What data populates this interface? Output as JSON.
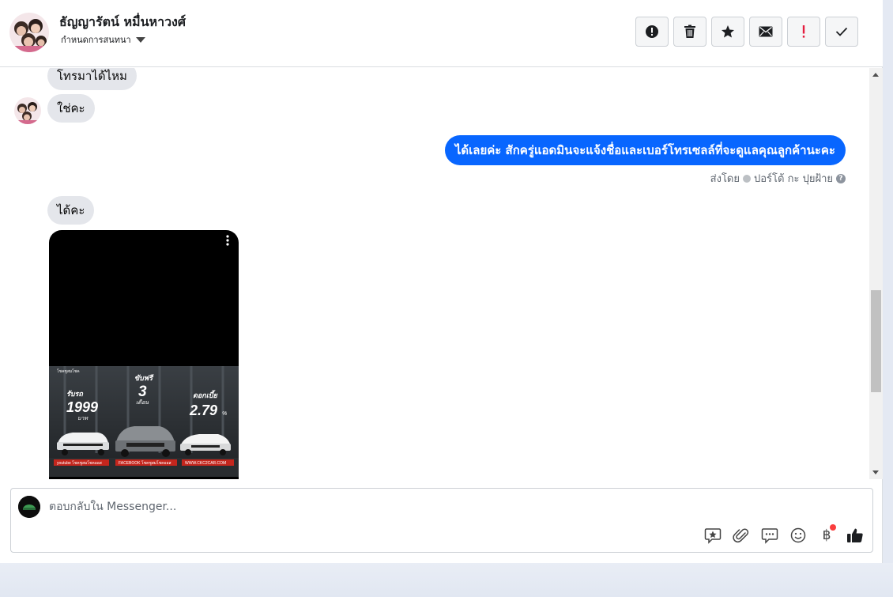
{
  "header": {
    "contact_name": "ธัญญารัตน์ หมื่นหาวงศ์",
    "assign_label": "กำหนดการสนทนา",
    "actions": [
      {
        "id": "report",
        "icon": "alert-circle-icon"
      },
      {
        "id": "delete",
        "icon": "trash-icon"
      },
      {
        "id": "star",
        "icon": "star-icon"
      },
      {
        "id": "mark-unread",
        "icon": "envelope-icon"
      },
      {
        "id": "follow-up",
        "icon": "exclamation-icon"
      },
      {
        "id": "done",
        "icon": "checkmark-icon"
      }
    ]
  },
  "thread": {
    "messages": [
      {
        "direction": "in",
        "text": "โทรมาได้ไหม"
      },
      {
        "direction": "in",
        "text": "ใช่คะ"
      },
      {
        "direction": "out",
        "text": "ได้เลยค่ะ สักครู่แอดมินจะแจ้งชื่อและเบอร์โทรเซลล์ที่จะดูแลคุณลูกค้านะคะ"
      },
      {
        "direction": "in",
        "text": "ได้คะ"
      }
    ],
    "sent_by_label": "ส่งโดย",
    "sent_by_name": "ปอร์โต้ กะ ปุยฝ้าย",
    "promo": {
      "brand": "โชคชูสมโชค",
      "col1_label": "รับรถ",
      "col1_value": "1999",
      "col1_unit": "บาท",
      "col2_label": "ขับฟรี",
      "col2_value": "3",
      "col2_unit": "เดือน",
      "col3_label": "ดอกเบี้ย",
      "col3_value": "2.79",
      "col3_unit": "%",
      "footer_1": "youtube โชคชูสมโชคออส",
      "footer_2": "FACEBOOK โชคชูสมโชคออส",
      "footer_3": "WWW.CKC2CAR.COM"
    }
  },
  "composer": {
    "placeholder": "ตอบกลับใน Messenger...",
    "tools": [
      "saved-reply-icon",
      "paperclip-icon",
      "chat-bubbles-icon",
      "emoji-icon",
      "baht-icon",
      "thumbs-up-icon"
    ],
    "baht_symbol": "฿"
  },
  "colors": {
    "accent": "#0866ff",
    "incoming_bubble": "#e4e6eb",
    "alert_red": "#fa3e3e"
  }
}
